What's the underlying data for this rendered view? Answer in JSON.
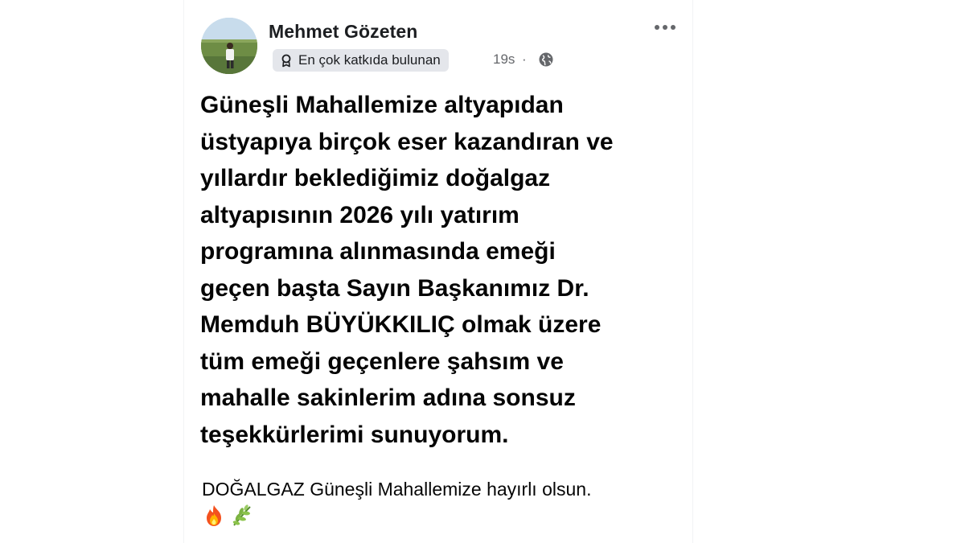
{
  "post": {
    "author": {
      "name": "Mehmet Gözeten",
      "badge_label": "En çok katkıda bulunan",
      "badge_icon": "contributor-badge-icon"
    },
    "time": "19s",
    "separator": "·",
    "audience_icon": "globe-icon",
    "menu_icon": "more-options-icon",
    "headline": "Güneşli Mahallemize altyapıdan\nüstyapıya birçok eser kazandıran ve\nyıllardır beklediğimiz doğalgaz\naltyapısının 2026 yılı yatırım\nprogramına alınmasında emeği\ngeçen başta Sayın Başkanımız Dr.\nMemduh BÜYÜKKILIÇ olmak üzere\ntüm emeği geçenlere şahsım ve\nmahalle sakinlerim adına sonsuz\nteşekkürlerimi sunuyorum.",
    "caption": "DOĞALGAZ Güneşli Mahallemize hayırlı olsun.",
    "emojis": [
      "fire-emoji",
      "herb-emoji"
    ]
  },
  "colors": {
    "background": "#ffffff",
    "text_primary": "#050505",
    "text_secondary": "#65676b",
    "badge_bg": "#e4e6eb"
  }
}
